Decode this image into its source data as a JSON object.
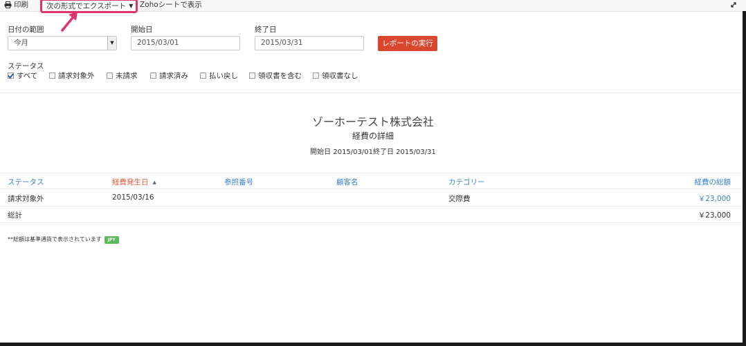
{
  "toolbar": {
    "print_label": "印刷",
    "export_label": "次の形式でエクスポート",
    "zoho_label": "Zohoシートで表示"
  },
  "filters": {
    "date_range_label": "日付の範囲",
    "date_range_value": "今月",
    "start_label": "開始日",
    "start_value": "2015/03/01",
    "end_label": "終了日",
    "end_value": "2015/03/31",
    "run_button": "レポートの実行",
    "status_label": "ステータス",
    "status_options": [
      {
        "label": "すべて",
        "checked": true
      },
      {
        "label": "請求対象外",
        "checked": false
      },
      {
        "label": "未請求",
        "checked": false
      },
      {
        "label": "請求済み",
        "checked": false
      },
      {
        "label": "払い戻し",
        "checked": false
      },
      {
        "label": "領収書を含む",
        "checked": false
      },
      {
        "label": "領収書なし",
        "checked": false
      }
    ]
  },
  "report": {
    "company": "ゾーホーテスト株式会社",
    "title": "経費の詳細",
    "period": "開始日 2015/03/01終了日 2015/03/31"
  },
  "table": {
    "headers": [
      "ステータス",
      "経費発生日",
      "参照番号",
      "顧客名",
      "カテゴリー",
      "経費の総額"
    ],
    "rows": [
      {
        "status": "請求対象外",
        "date": "2015/03/16",
        "ref": "",
        "customer": "",
        "category": "交際費",
        "amount": "￥23,000"
      }
    ],
    "total_label": "総計",
    "total_amount": "￥23,000"
  },
  "footnote": {
    "text": "**総額は基準通貨で表示されています",
    "currency_badge": "JPY"
  },
  "colors": {
    "accent_blue": "#3b82c4",
    "active_header": "#e05a3f",
    "run_button": "#d9472e",
    "annotation": "#e0336b",
    "badge": "#5cb85c"
  }
}
